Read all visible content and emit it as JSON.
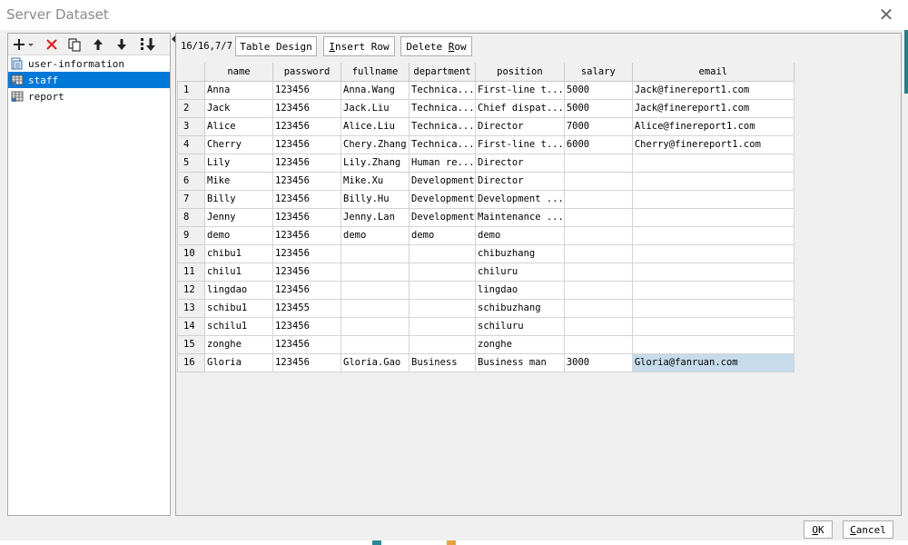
{
  "window": {
    "title": "Server Dataset"
  },
  "tree": {
    "items": [
      {
        "label": "user-information",
        "selected": false
      },
      {
        "label": "staff",
        "selected": true
      },
      {
        "label": "report",
        "selected": false
      }
    ]
  },
  "toolbar": {
    "counter": "16/16,7/7",
    "table_design": "Table Design",
    "insert_row_u": "I",
    "insert_row_rest": "nsert Row",
    "delete_row_main": "Delete ",
    "delete_row_u": "R",
    "delete_row_rest": "ow"
  },
  "table": {
    "columns": [
      "name",
      "password",
      "fullname",
      "department",
      "position",
      "salary",
      "email"
    ],
    "rows": [
      {
        "num": "1",
        "cells": [
          "Anna",
          "123456",
          "Anna.Wang",
          "Technica...",
          "First-line t...",
          "5000",
          "Jack@finereport1.com"
        ]
      },
      {
        "num": "2",
        "cells": [
          "Jack",
          "123456",
          "Jack.Liu",
          "Technica...",
          "Chief dispat...",
          "5000",
          "Jack@finereport1.com"
        ]
      },
      {
        "num": "3",
        "cells": [
          "Alice",
          "123456",
          "Alice.Liu",
          "Technica...",
          "Director",
          "7000",
          "Alice@finereport1.com"
        ]
      },
      {
        "num": "4",
        "cells": [
          "Cherry",
          "123456",
          "Chery.Zhang",
          "Technica...",
          "First-line t...",
          "6000",
          "Cherry@finereport1.com"
        ]
      },
      {
        "num": "5",
        "cells": [
          "Lily",
          "123456",
          "Lily.Zhang",
          "Human re...",
          "Director",
          "",
          ""
        ]
      },
      {
        "num": "6",
        "cells": [
          "Mike",
          "123456",
          "Mike.Xu",
          "Development",
          "Director",
          "",
          ""
        ]
      },
      {
        "num": "7",
        "cells": [
          "Billy",
          "123456",
          "Billy.Hu",
          "Development",
          "Development ...",
          "",
          ""
        ]
      },
      {
        "num": "8",
        "cells": [
          "Jenny",
          "123456",
          "Jenny.Lan",
          "Development",
          "Maintenance ...",
          "",
          ""
        ]
      },
      {
        "num": "9",
        "cells": [
          "demo",
          "123456",
          "demo",
          "demo",
          "demo",
          "",
          ""
        ]
      },
      {
        "num": "10",
        "cells": [
          "chibu1",
          "123456",
          "",
          "",
          "chibuzhang",
          "",
          ""
        ]
      },
      {
        "num": "11",
        "cells": [
          "chilu1",
          "123456",
          "",
          "",
          "chiluru",
          "",
          ""
        ]
      },
      {
        "num": "12",
        "cells": [
          "lingdao",
          "123456",
          "",
          "",
          "lingdao",
          "",
          ""
        ]
      },
      {
        "num": "13",
        "cells": [
          "schibu1",
          "123455",
          "",
          "",
          "schibuzhang",
          "",
          ""
        ]
      },
      {
        "num": "14",
        "cells": [
          "schilu1",
          "123456",
          "",
          "",
          "schiluru",
          "",
          ""
        ]
      },
      {
        "num": "15",
        "cells": [
          "zonghe",
          "123456",
          "",
          "",
          "zonghe",
          "",
          ""
        ]
      },
      {
        "num": "16",
        "cells": [
          "Gloria",
          "123456",
          "Gloria.Gao",
          "Business",
          "Business man",
          "3000",
          "Gloria@fanruan.com"
        ]
      }
    ],
    "selected_cell": {
      "row": 16,
      "col": "email"
    }
  },
  "footer": {
    "ok_u": "O",
    "ok_rest": "K",
    "cancel_u": "C",
    "cancel_rest": "ancel"
  },
  "colors": {
    "selection": "#0078d7",
    "cell_selected": "#c6dcea",
    "delete_icon": "#e02020"
  },
  "icons": [
    "add-icon",
    "delete-icon",
    "copy-icon",
    "move-up-icon",
    "move-down-icon",
    "sort-icon"
  ]
}
